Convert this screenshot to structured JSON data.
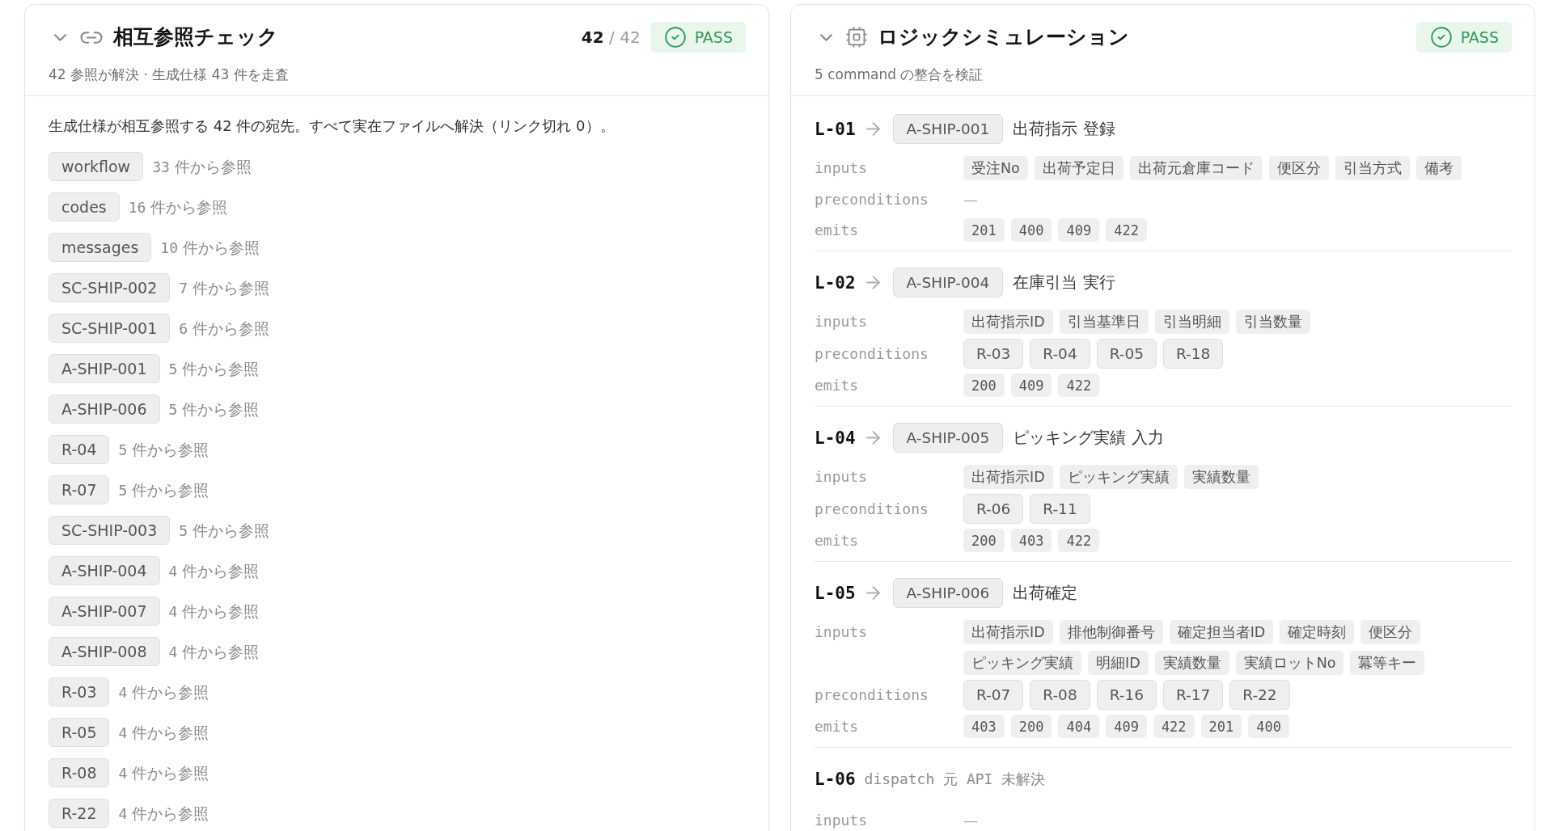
{
  "cross_reference": {
    "expanded": true,
    "title": "相互参照チェック",
    "subtitle": "42 参照が解決 · 生成仕様 43 件を走査",
    "count": {
      "value": "42",
      "separator": "/",
      "total": "42"
    },
    "status": {
      "kind": "pass",
      "label": "PASS"
    },
    "description": "生成仕様が相互参照する 42 件の宛先。すべて実在ファイルへ解決（リンク切れ 0）。",
    "references": [
      {
        "id": "workflow",
        "count": "33",
        "unit": "件から参照"
      },
      {
        "id": "codes",
        "count": "16",
        "unit": "件から参照"
      },
      {
        "id": "messages",
        "count": "10",
        "unit": "件から参照"
      },
      {
        "id": "SC-SHIP-002",
        "count": "7",
        "unit": "件から参照"
      },
      {
        "id": "SC-SHIP-001",
        "count": "6",
        "unit": "件から参照"
      },
      {
        "id": "A-SHIP-001",
        "count": "5",
        "unit": "件から参照"
      },
      {
        "id": "A-SHIP-006",
        "count": "5",
        "unit": "件から参照"
      },
      {
        "id": "R-04",
        "count": "5",
        "unit": "件から参照"
      },
      {
        "id": "R-07",
        "count": "5",
        "unit": "件から参照"
      },
      {
        "id": "SC-SHIP-003",
        "count": "5",
        "unit": "件から参照"
      },
      {
        "id": "A-SHIP-004",
        "count": "4",
        "unit": "件から参照"
      },
      {
        "id": "A-SHIP-007",
        "count": "4",
        "unit": "件から参照"
      },
      {
        "id": "A-SHIP-008",
        "count": "4",
        "unit": "件から参照"
      },
      {
        "id": "R-03",
        "count": "4",
        "unit": "件から参照"
      },
      {
        "id": "R-05",
        "count": "4",
        "unit": "件から参照"
      },
      {
        "id": "R-08",
        "count": "4",
        "unit": "件から参照"
      },
      {
        "id": "R-22",
        "count": "4",
        "unit": "件から参照"
      }
    ]
  },
  "logic_simulation": {
    "expanded": true,
    "title": "ロジックシミュレーション",
    "subtitle": "5 command の整合を検証",
    "status": {
      "kind": "pass",
      "label": "PASS"
    },
    "commands": [
      {
        "id": "L-01",
        "action": "A-SHIP-001",
        "name": "出荷指示 登録",
        "fields": [
          {
            "label": "inputs",
            "kind": "inputs",
            "values": [
              "受注No",
              "出荷予定日",
              "出荷元倉庫コード",
              "便区分",
              "引当方式",
              "備考"
            ]
          },
          {
            "label": "preconditions",
            "kind": "empty",
            "text": "—"
          },
          {
            "label": "emits",
            "kind": "codes",
            "values": [
              "201",
              "400",
              "409",
              "422"
            ]
          }
        ]
      },
      {
        "id": "L-02",
        "action": "A-SHIP-004",
        "name": "在庫引当 実行",
        "fields": [
          {
            "label": "inputs",
            "kind": "inputs",
            "values": [
              "出荷指示ID",
              "引当基準日",
              "引当明細",
              "引当数量"
            ]
          },
          {
            "label": "preconditions",
            "kind": "rules",
            "values": [
              "R-03",
              "R-04",
              "R-05",
              "R-18"
            ]
          },
          {
            "label": "emits",
            "kind": "codes",
            "values": [
              "200",
              "409",
              "422"
            ]
          }
        ]
      },
      {
        "id": "L-04",
        "action": "A-SHIP-005",
        "name": "ピッキング実績 入力",
        "fields": [
          {
            "label": "inputs",
            "kind": "inputs",
            "values": [
              "出荷指示ID",
              "ピッキング実績",
              "実績数量"
            ]
          },
          {
            "label": "preconditions",
            "kind": "rules",
            "values": [
              "R-06",
              "R-11"
            ]
          },
          {
            "label": "emits",
            "kind": "codes",
            "values": [
              "200",
              "403",
              "422"
            ]
          }
        ]
      },
      {
        "id": "L-05",
        "action": "A-SHIP-006",
        "name": "出荷確定",
        "fields": [
          {
            "label": "inputs",
            "kind": "inputs",
            "values": [
              "出荷指示ID",
              "排他制御番号",
              "確定担当者ID",
              "確定時刻",
              "便区分",
              "ピッキング実績",
              "明細ID",
              "実績数量",
              "実績ロットNo",
              "冪等キー"
            ]
          },
          {
            "label": "preconditions",
            "kind": "rules",
            "values": [
              "R-07",
              "R-08",
              "R-16",
              "R-17",
              "R-22"
            ]
          },
          {
            "label": "emits",
            "kind": "codes",
            "values": [
              "403",
              "200",
              "404",
              "409",
              "422",
              "201",
              "400"
            ]
          }
        ]
      },
      {
        "id": "L-06",
        "note": "dispatch 元 API 未解決",
        "fields": [
          {
            "label": "inputs",
            "kind": "empty",
            "text": "—"
          }
        ]
      }
    ]
  }
}
